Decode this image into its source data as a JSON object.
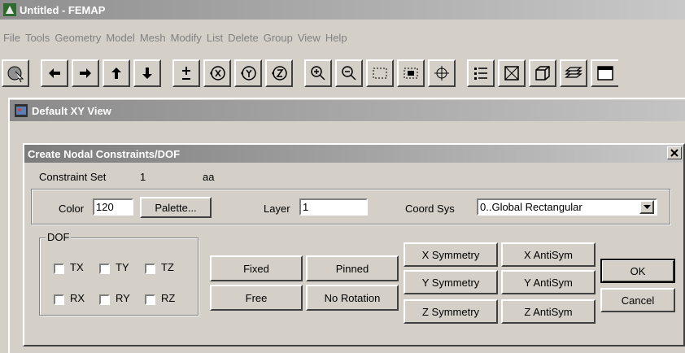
{
  "app": {
    "title": "Untitled - FEMAP"
  },
  "menu": [
    "File",
    "Tools",
    "Geometry",
    "Model",
    "Mesh",
    "Modify",
    "List",
    "Delete",
    "Group",
    "View",
    "Help"
  ],
  "toolbar_icons": [
    "select-icon",
    "arrow-left-icon",
    "arrow-right-icon",
    "arrow-up-icon",
    "arrow-down-icon",
    "plus-minus-icon",
    "rotate-x-icon",
    "rotate-y-icon",
    "rotate-z-icon",
    "zoom-in-icon",
    "zoom-out-icon",
    "zoom-window-icon",
    "autoscale-icon",
    "center-icon",
    "list-icon",
    "box-icon",
    "cube-icon",
    "layers-icon",
    "window-icon"
  ],
  "view": {
    "title": "Default XY View"
  },
  "dialog": {
    "title": "Create Nodal Constraints/DOF",
    "close_label": "×",
    "constraint_set_label": "Constraint Set",
    "constraint_set_id": "1",
    "constraint_set_name": "aa",
    "color_label": "Color",
    "color_value": "120",
    "palette_label": "Palette...",
    "layer_label": "Layer",
    "layer_value": "1",
    "coord_label": "Coord Sys",
    "coord_value": "0..Global Rectangular",
    "dof_label": "DOF",
    "dof": {
      "tx": "TX",
      "ty": "TY",
      "tz": "TZ",
      "rx": "RX",
      "ry": "RY",
      "rz": "RZ"
    },
    "buttons": {
      "fixed": "Fixed",
      "pinned": "Pinned",
      "free": "Free",
      "no_rotation": "No Rotation",
      "x_sym": "X Symmetry",
      "y_sym": "Y Symmetry",
      "z_sym": "Z Symmetry",
      "x_anti": "X AntiSym",
      "y_anti": "Y AntiSym",
      "z_anti": "Z AntiSym",
      "ok": "OK",
      "cancel": "Cancel"
    }
  }
}
